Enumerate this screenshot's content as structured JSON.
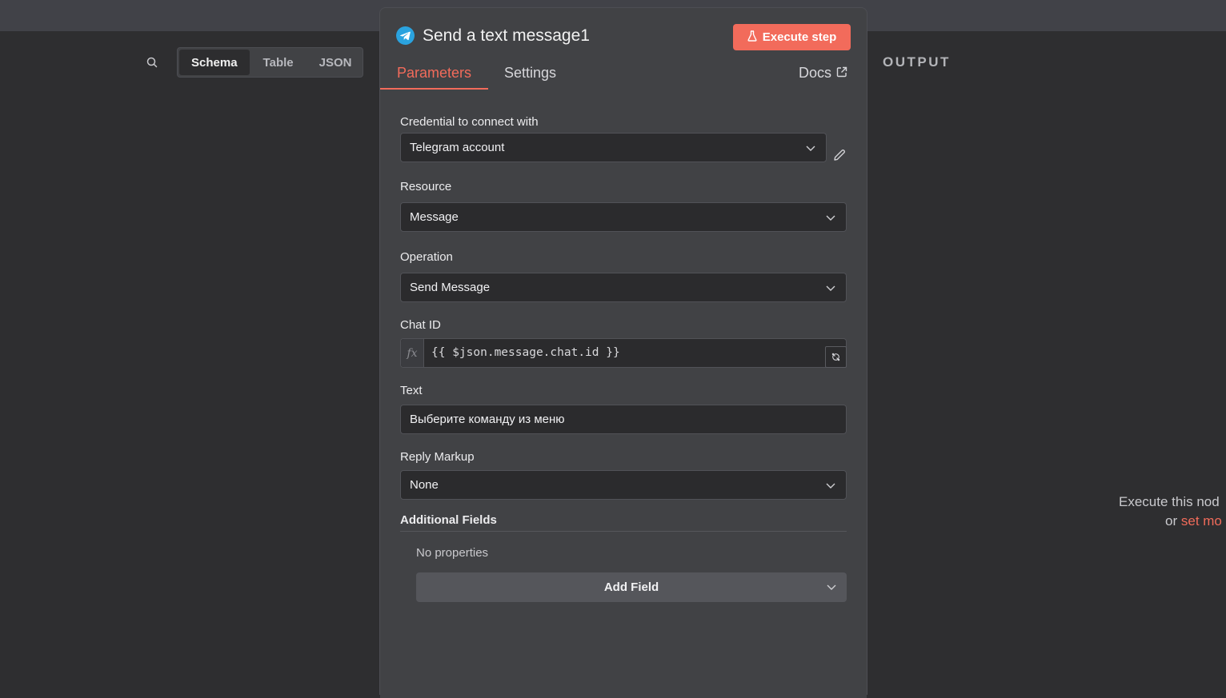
{
  "input_panel": {
    "view_options": [
      "Schema",
      "Table",
      "JSON"
    ],
    "active_view": "Schema"
  },
  "output_panel": {
    "title": "OUTPUT",
    "hint_line1": "Execute this nod",
    "hint_line2_prefix": "or",
    "hint_line2_link": "set mo"
  },
  "node": {
    "title": "Send a text message1",
    "icon": "telegram-icon",
    "execute_label": "Execute step",
    "tabs": [
      "Parameters",
      "Settings"
    ],
    "active_tab": "Parameters",
    "docs_label": "Docs",
    "accent_color": "#f26b5b"
  },
  "params": {
    "credential_label": "Credential to connect with",
    "credential_value": "Telegram account",
    "resource_label": "Resource",
    "resource_value": "Message",
    "operation_label": "Operation",
    "operation_value": "Send Message",
    "chat_id_label": "Chat ID",
    "chat_id_fx": "fx",
    "chat_id_value": "{{ $json.message.chat.id }}",
    "text_label": "Text",
    "text_value": "Выберите команду из меню",
    "reply_markup_label": "Reply Markup",
    "reply_markup_value": "None",
    "additional_fields_label": "Additional Fields",
    "no_properties": "No properties",
    "add_field_label": "Add Field"
  }
}
